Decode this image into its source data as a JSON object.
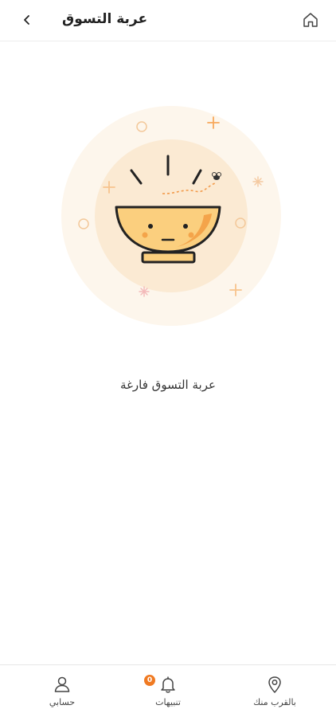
{
  "header": {
    "title": "عربة التسوق"
  },
  "main": {
    "empty_message": "عربة التسوق فارغة"
  },
  "bottom_nav": {
    "items": [
      {
        "label": "حسابي",
        "icon": "user-icon"
      },
      {
        "label": "تنبيهات",
        "icon": "bell-icon",
        "badge": "0"
      },
      {
        "label": "بالقرب منك",
        "icon": "location-pin-icon"
      }
    ]
  },
  "colors": {
    "accent": "#f07a22",
    "bowl": "#fbd07f",
    "glow": "#fdf3e4"
  }
}
